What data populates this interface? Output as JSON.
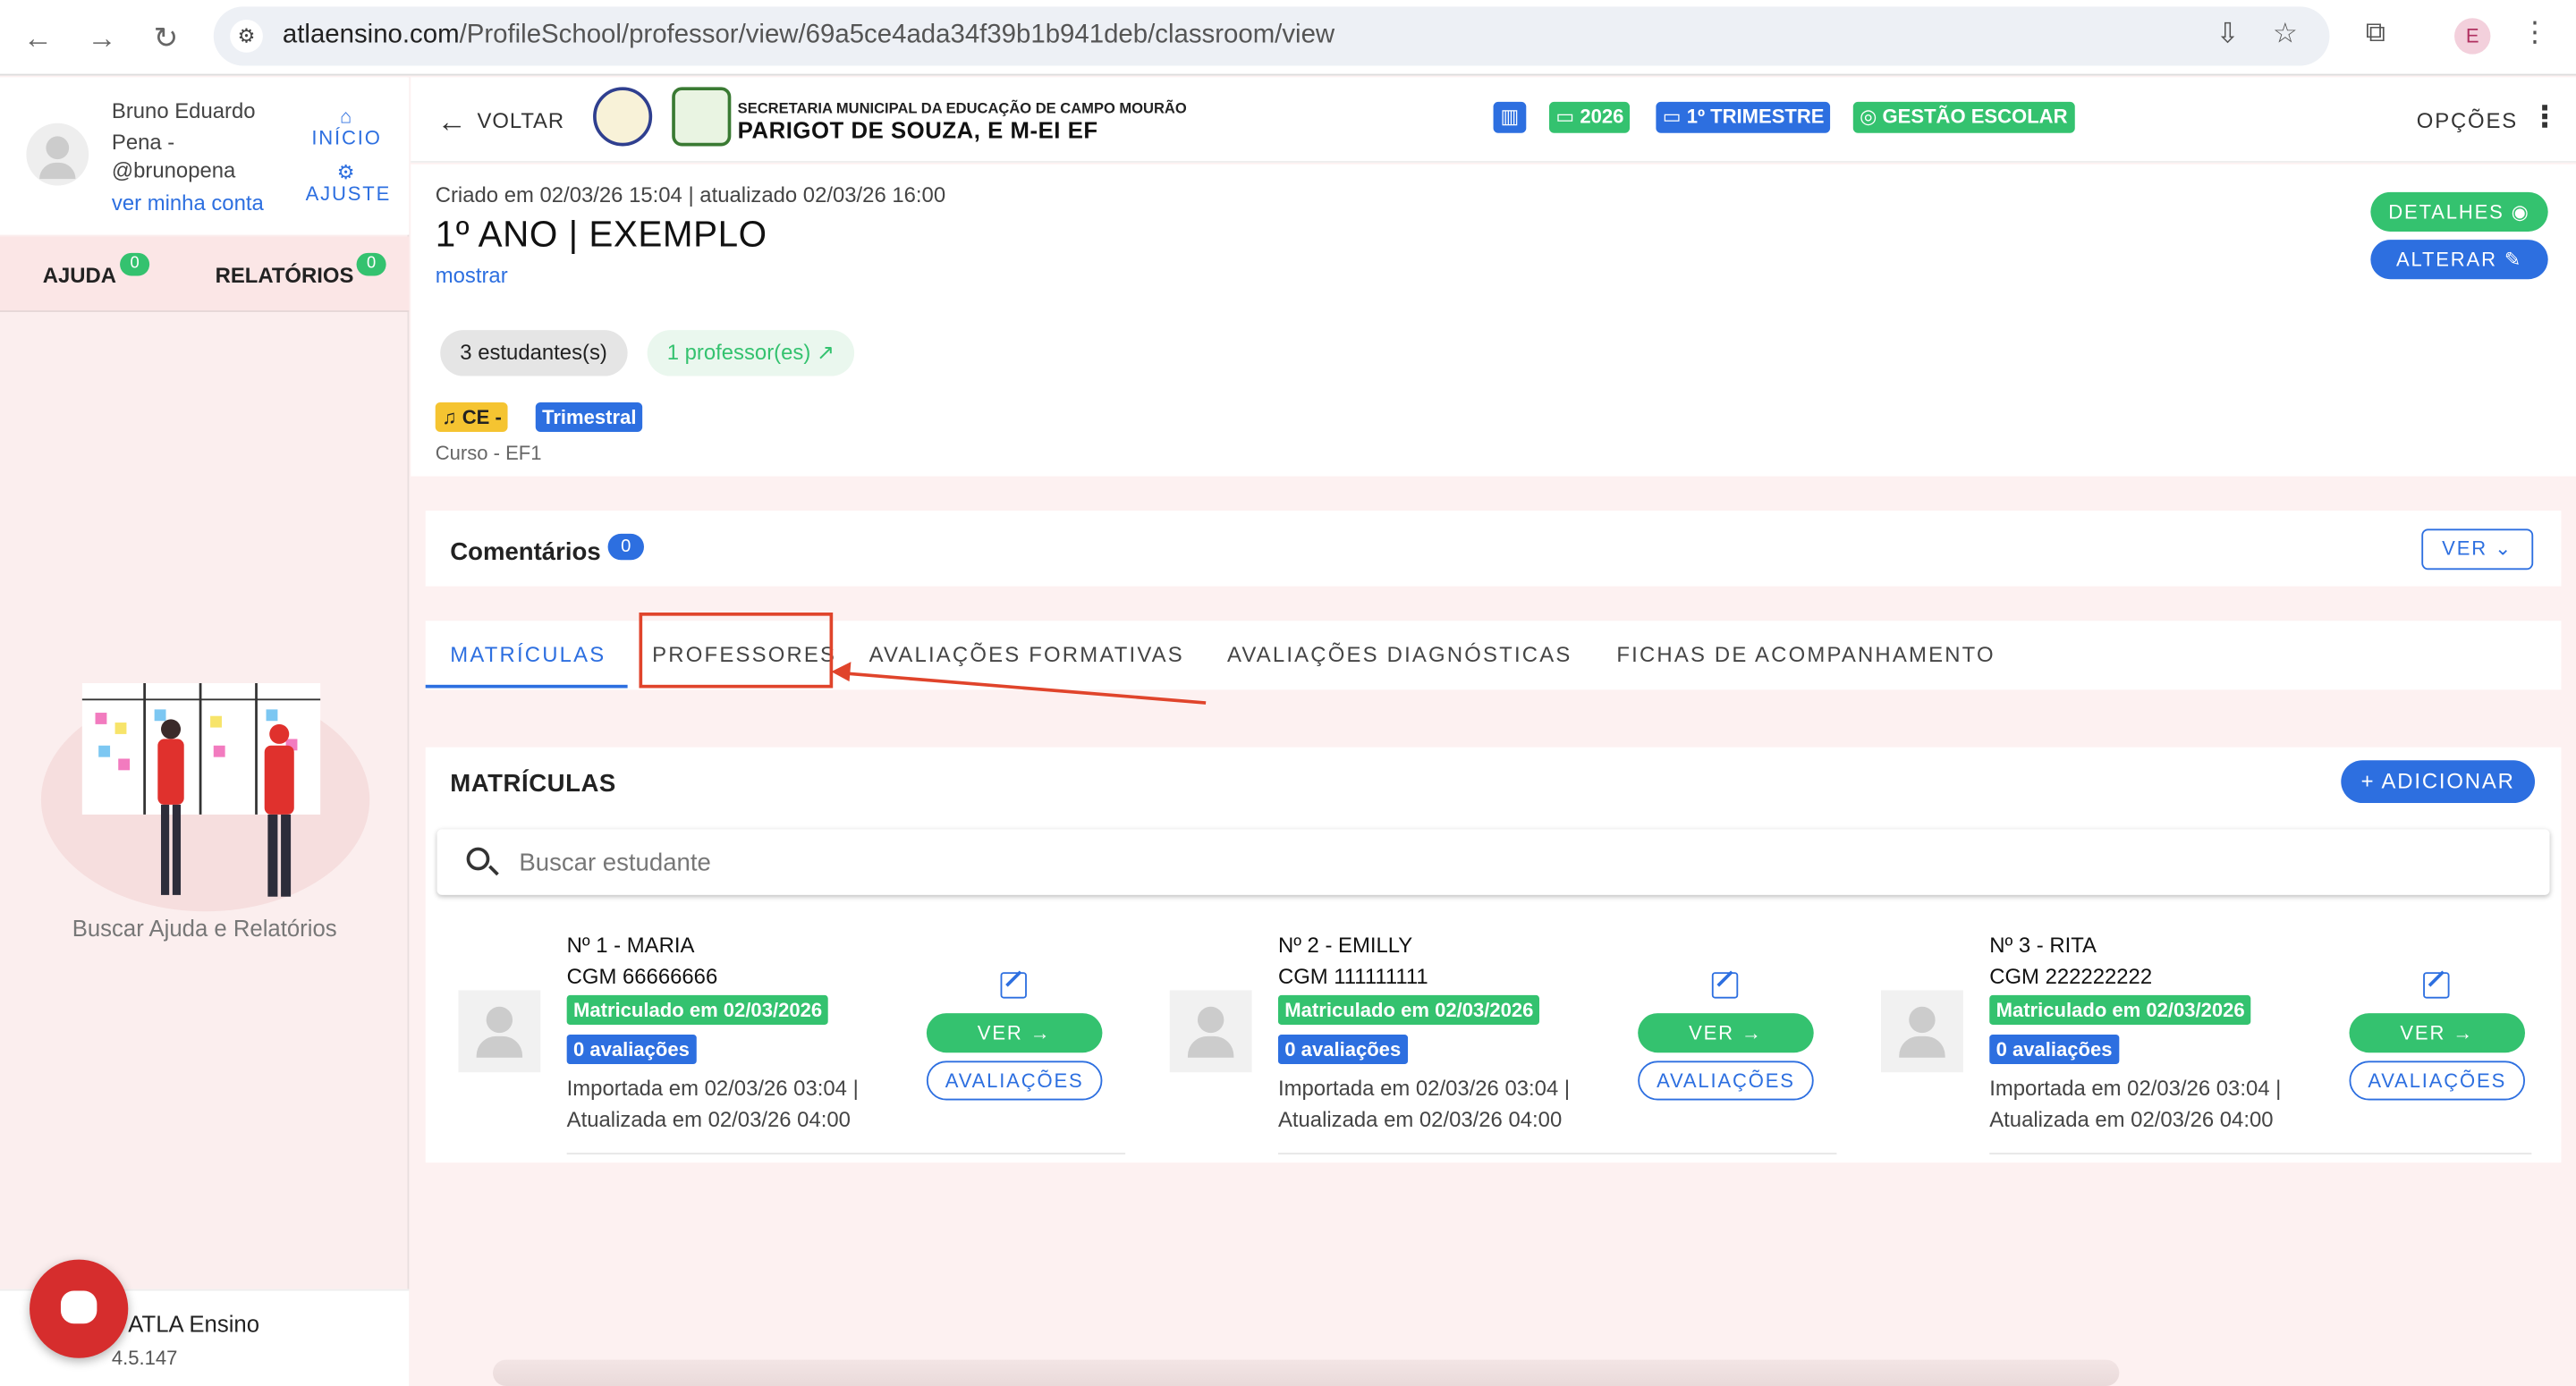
{
  "browser": {
    "url_domain": "atlaensino.com",
    "url_path": "/ProfileSchool/professor/view/69a5ce4ada34f39b1b941deb/classroom/view",
    "profile_initial": "E"
  },
  "sidebar": {
    "user_name": "Bruno Eduardo Pena -",
    "user_handle": "@brunopena",
    "account_link": "ver minha conta",
    "nav": {
      "home": "INÍCIO",
      "settings": "AJUSTE"
    },
    "tabs": [
      {
        "label": "AJUDA",
        "count": "0"
      },
      {
        "label": "RELATÓRIOS",
        "count": "0"
      }
    ],
    "caption": "Buscar Ajuda e Relatórios",
    "brand": "ATLA Ensino",
    "version": "4.5.147"
  },
  "topbar": {
    "back_label": "VOLTAR",
    "school_dept": "SECRETARIA MUNICIPAL DA EDUCAÇÃO DE CAMPO MOURÃO",
    "school_name": "PARIGOT DE SOUZA, E M-EI EF",
    "chips": {
      "year": "2026",
      "term": "1º TRIMESTRE",
      "management": "GESTÃO ESCOLAR"
    },
    "options_label": "OPÇÕES",
    "colors": {
      "blue": "#2d6fe0",
      "green": "#34c26f"
    }
  },
  "classroom": {
    "meta": "Criado em 02/03/26 15:04 | atualizado 02/03/26 16:00",
    "title": "1º ANO | EXEMPLO",
    "show_link": "mostrar",
    "students_pill": "3 estudantes(s)",
    "teachers_pill": "1 professor(es)",
    "tag_ce": "CE -",
    "tag_period": "Trimestral",
    "course": "Curso - EF1",
    "details_button": "DETALHES",
    "edit_button": "ALTERAR"
  },
  "comments": {
    "title": "Comentários",
    "count": "0",
    "view_button": "VER"
  },
  "tabs": [
    {
      "label": "MATRÍCULAS",
      "active": true
    },
    {
      "label": "PROFESSORES",
      "active": false
    },
    {
      "label": "AVALIAÇÕES FORMATIVAS",
      "active": false
    },
    {
      "label": "AVALIAÇÕES DIAGNÓSTICAS",
      "active": false
    },
    {
      "label": "FICHAS DE ACOMPANHAMENTO",
      "active": false
    }
  ],
  "enrollments": {
    "title": "MATRÍCULAS",
    "add_button": "ADICIONAR",
    "search_placeholder": "Buscar estudante",
    "view_button": "VER",
    "evaluations_button": "AVALIAÇÕES",
    "students": [
      {
        "name": "Nº 1 - MARIA",
        "cgm": "CGM 66666666",
        "status": "Matriculado em 02/03/2026",
        "evaluations": "0 avaliações",
        "imported": "Importada em 02/03/26 03:04 |",
        "updated": "Atualizada em 02/03/26 04:00"
      },
      {
        "name": "Nº 2 - EMILLY",
        "cgm": "CGM 111111111",
        "status": "Matriculado em 02/03/2026",
        "evaluations": "0 avaliações",
        "imported": "Importada em 02/03/26 03:04 |",
        "updated": "Atualizada em 02/03/26 04:00"
      },
      {
        "name": "Nº 3 - RITA",
        "cgm": "CGM 222222222",
        "status": "Matriculado em 02/03/2026",
        "evaluations": "0 avaliações",
        "imported": "Importada em 02/03/26 03:04 |",
        "updated": "Atualizada em 02/03/26 04:00"
      }
    ]
  }
}
